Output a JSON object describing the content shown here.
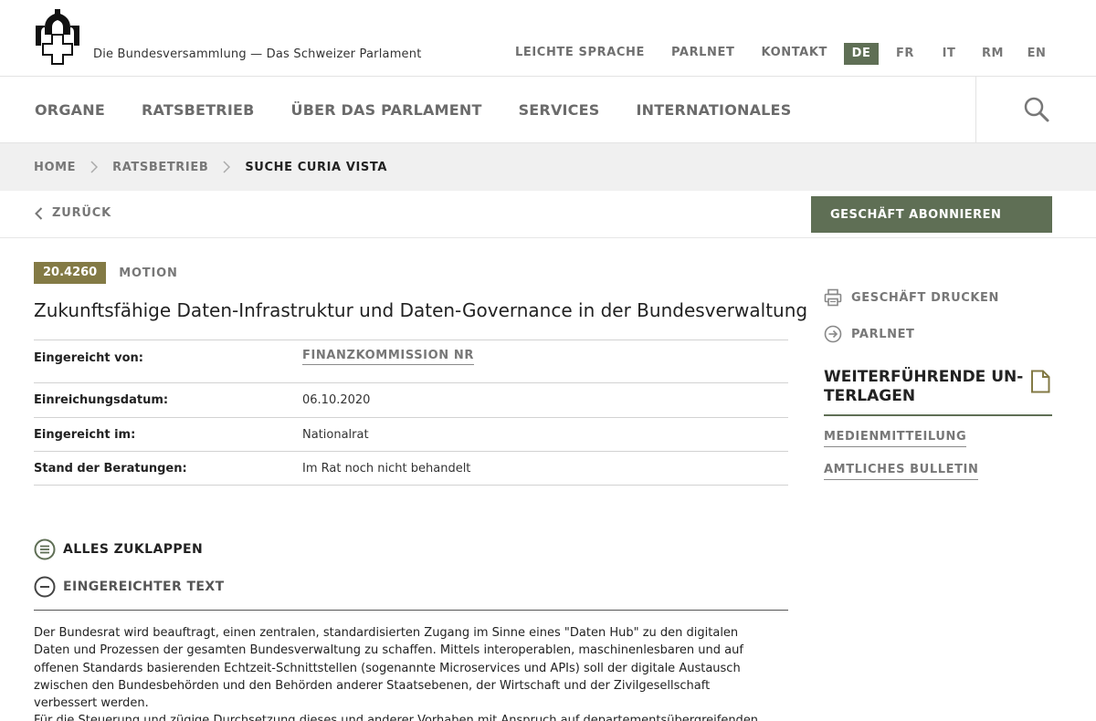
{
  "header": {
    "site_title": "Die Bundesversammlung — Das Schweizer Parlament",
    "links": [
      "LEICHTE SPRACHE",
      "PARLNET",
      "KONTAKT"
    ],
    "languages": [
      "DE",
      "FR",
      "IT",
      "RM",
      "EN"
    ],
    "active_language": "DE"
  },
  "nav": {
    "items": [
      "ORGANE",
      "RATSBETRIEB",
      "ÜBER DAS PARLAMENT",
      "SERVICES",
      "INTERNATIONALES"
    ]
  },
  "breadcrumb": [
    "HOME",
    "RATSBETRIEB",
    "SUCHE CURIA VISTA"
  ],
  "actions": {
    "back_label": "ZURÜCK",
    "subscribe_label": "GESCHÄFT ABONNIEREN"
  },
  "business": {
    "number": "20.4260",
    "type": "MOTION",
    "title": "Zukunftsfähige Daten-Infrastruktur und Daten-Governance in der Bundesverwaltung",
    "details": [
      {
        "label": "Eingereicht von:",
        "value": "FINANZKOMMISSION NR"
      },
      {
        "label": "Einreichungsdatum:",
        "value": "06.10.2020"
      },
      {
        "label": "Eingereicht im:",
        "value": "Nationalrat"
      },
      {
        "label": "Stand der Beratungen:",
        "value": "Im Rat noch nicht behandelt"
      }
    ]
  },
  "sections": {
    "collapse_all_label": "ALLES ZUKLAPPEN",
    "submitted_text_label": "EINGEREICHTER TEXT",
    "submitted_text_lines": [
      "Der Bundesrat wird beauftragt, einen zentralen, standardisierten Zugang im Sinne eines \"Daten Hub\" zu den digitalen",
      "Daten und Prozessen der gesamten Bundesverwaltung zu schaffen. Mittels interoperablen, maschinenlesbaren und auf",
      "offenen Standards basierenden Echtzeit-Schnittstellen (sogenannte Microservices und APIs) soll der digitale Austausch",
      "zwischen den Bundesbehörden und den Behörden anderer Staatsebenen, der Wirtschaft und der Zivilgesellschaft",
      "verbessert werden.",
      "Für die Steuerung und zügige Durchsetzung dieses und anderer Vorhaben mit Anspruch auf departementsübergreifenden"
    ]
  },
  "sidebar": {
    "print_label": "GESCHÄFT DRUCKEN",
    "parlnet_label": "PARLNET",
    "docs_title": "WEITERFÜHRENDE UN-TERLAGEN",
    "docs_links": [
      "MEDIENMITTEILUNG",
      "AMTLICHES BULLETIN"
    ]
  },
  "colors": {
    "accent_green": "#5f6f55",
    "badge_olive": "#837a45",
    "breadcrumb_bg": "#f0f0f0"
  }
}
